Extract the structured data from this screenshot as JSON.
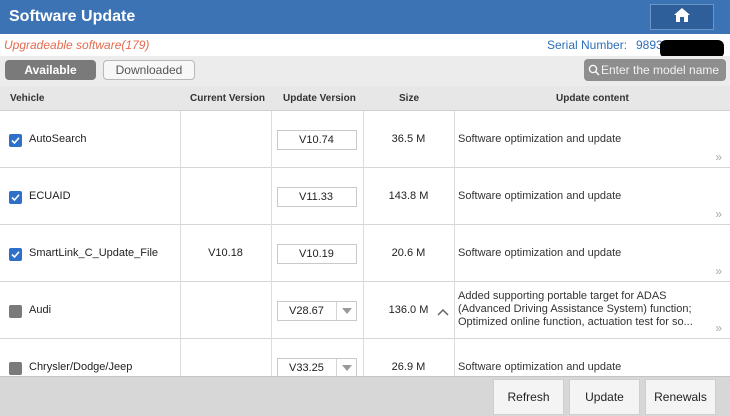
{
  "header": {
    "title": "Software Update",
    "home_icon": "home-icon"
  },
  "info": {
    "upgradeable": "Upgradeable software(179)",
    "serial_label": "Serial Number:",
    "serial_value": "9893"
  },
  "tabs": {
    "available": "Available",
    "downloaded": "Downloaded",
    "active": "available"
  },
  "search": {
    "placeholder": "Enter the model name",
    "icon": "search-icon"
  },
  "table": {
    "columns": [
      "Vehicle",
      "Current Version",
      "Update Version",
      "Size",
      "Update content"
    ],
    "rows": [
      {
        "checked": true,
        "vehicle": "AutoSearch",
        "current": "",
        "update": "V10.74",
        "dropdown": false,
        "size": "36.5 M",
        "content": "Software optimization and update"
      },
      {
        "checked": true,
        "vehicle": "ECUAID",
        "current": "",
        "update": "V11.33",
        "dropdown": false,
        "size": "143.8 M",
        "content": "Software optimization and update"
      },
      {
        "checked": true,
        "vehicle": "SmartLink_C_Update_File",
        "current": "V10.18",
        "update": "V10.19",
        "dropdown": false,
        "size": "20.6 M",
        "content": "Software optimization and update"
      },
      {
        "checked": false,
        "vehicle": "Audi",
        "current": "",
        "update": "V28.67",
        "dropdown": true,
        "size": "136.0 M",
        "content": "Added supporting portable target for ADAS (Advanced Driving Assistance System) function; Optimized online function, actuation test for so..."
      },
      {
        "checked": false,
        "vehicle": "Chrysler/Dodge/Jeep",
        "current": "",
        "update": "V33.25",
        "dropdown": true,
        "size": "26.9 M",
        "content": "Software optimization and update"
      }
    ],
    "more_glyph": "»"
  },
  "footer": {
    "refresh": "Refresh",
    "update": "Update",
    "renewals": "Renewals"
  },
  "colors": {
    "title_bar": "#3c73b5",
    "accent_blue": "#2e6fb8",
    "warning_orange": "#e46b4f",
    "checkbox_on": "#2e6fc9"
  }
}
